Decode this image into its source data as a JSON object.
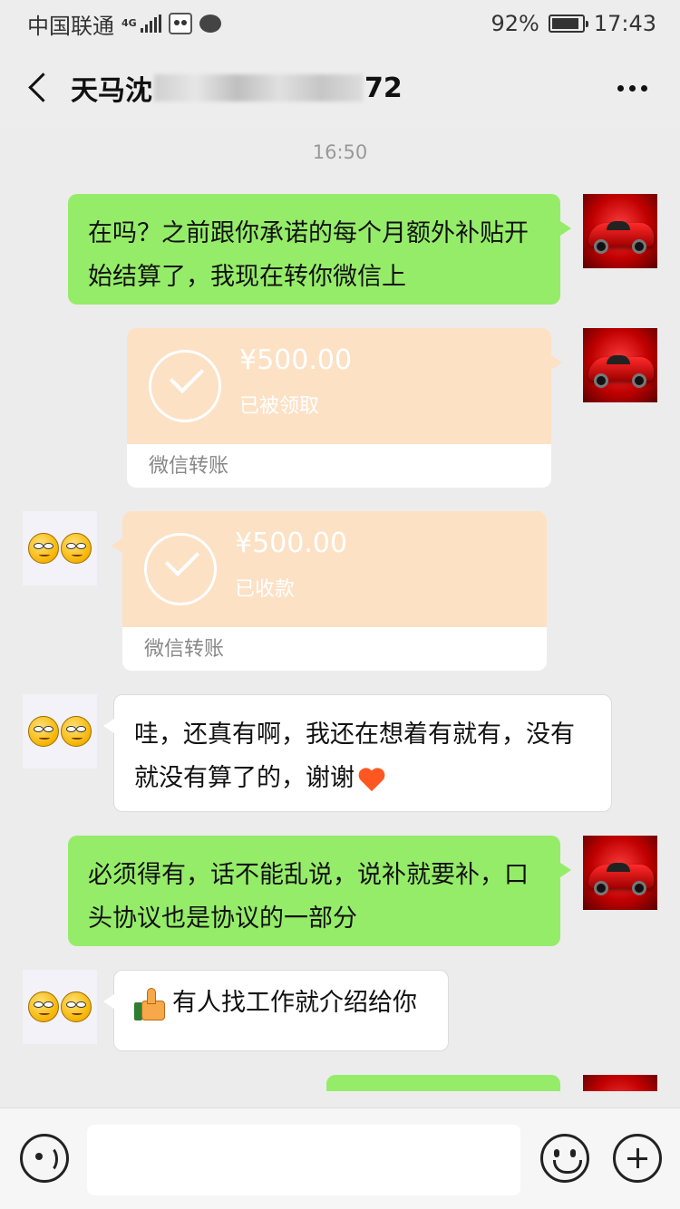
{
  "status_bar": {
    "carrier": "中国联通",
    "network": "4G",
    "battery_percent": "92%",
    "battery_level": 0.92,
    "time": "17:43"
  },
  "header": {
    "title_prefix": "天马沈",
    "title_suffix": "72",
    "back_icon": "chevron-left-icon",
    "more_icon": "more-dots-icon"
  },
  "chat": {
    "timestamp": "16:50",
    "messages": [
      {
        "sender": "me",
        "type": "text",
        "text": "在吗？之前跟你承诺的每个月额外补贴开始结算了，我现在转你微信上"
      },
      {
        "sender": "me",
        "type": "transfer",
        "amount": "¥500.00",
        "status": "已被领取",
        "label": "微信转账"
      },
      {
        "sender": "other",
        "type": "transfer",
        "amount": "¥500.00",
        "status": "已收款",
        "label": "微信转账"
      },
      {
        "sender": "other",
        "type": "text",
        "text": "哇，还真有啊，我还在想着有就有，没有就没有算了的，谢谢",
        "emoji": "heart-icon"
      },
      {
        "sender": "me",
        "type": "text",
        "text": "必须得有，话不能乱说，说补就要补，口头协议也是协议的一部分"
      },
      {
        "sender": "other",
        "type": "text",
        "text": "有人找工作就介绍给你",
        "emoji": "thumbs-up-icon"
      },
      {
        "sender": "me",
        "type": "text",
        "text": ""
      }
    ]
  },
  "input_bar": {
    "text_value": "",
    "voice_icon": "voice-icon",
    "emoji_icon": "smiley-icon",
    "plus_icon": "plus-icon"
  },
  "colors": {
    "background": "#ececec",
    "my_bubble": "#95ec69",
    "other_bubble": "#ffffff",
    "transfer_top": "#fce1c5"
  }
}
